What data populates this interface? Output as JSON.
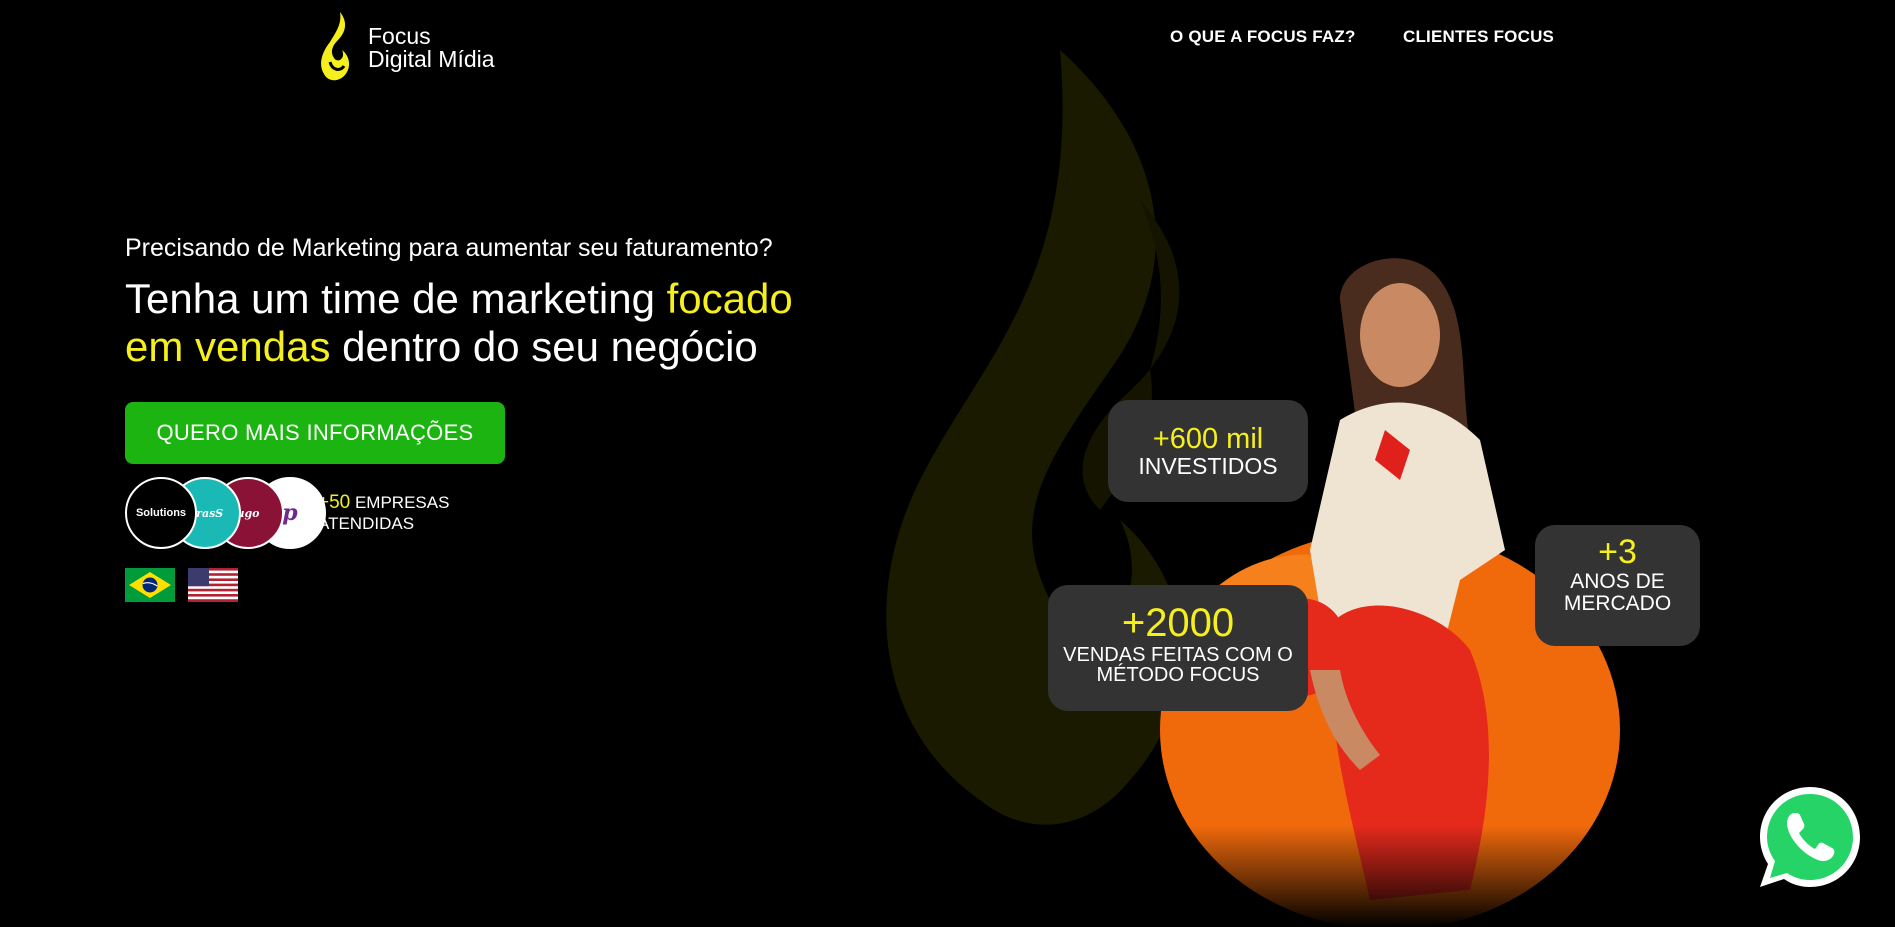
{
  "header": {
    "logo_line1": "Focus",
    "logo_line2": "Digital Mídia",
    "nav": [
      "O QUE A FOCUS FAZ?",
      "CLIENTES FOCUS"
    ]
  },
  "hero": {
    "eyebrow": "Precisando de Marketing para aumentar seu faturamento?",
    "headline_part1": "Tenha um time de marketing ",
    "headline_highlight": "focado em vendas",
    "headline_part2": " dentro do seu negócio",
    "cta_label": "QUERO MAIS INFORMAÇÕES",
    "clients_count": "+50",
    "clients_label_1": "EMPRESAS",
    "clients_label_2": "ATENDIDAS",
    "client_logos": [
      "Solutions",
      "GrasS",
      "ugo",
      "p"
    ]
  },
  "stats": [
    {
      "value": "+600 mil",
      "label": "INVESTIDOS"
    },
    {
      "value": "+2000",
      "label": "VENDAS FEITAS COM O MÉTODO FOCUS"
    },
    {
      "value": "+3",
      "label": "ANOS DE MERCADO"
    }
  ],
  "languages": [
    "brazil-flag-icon",
    "usa-flag-icon"
  ],
  "icons": {
    "whatsapp": "whatsapp-icon",
    "logo": "flame-logo-icon"
  },
  "colors": {
    "accent_yellow": "#f5ef1e",
    "cta_green": "#1bb410",
    "stat_bg": "#333333",
    "background": "#000000",
    "whatsapp_green": "#25d366"
  }
}
